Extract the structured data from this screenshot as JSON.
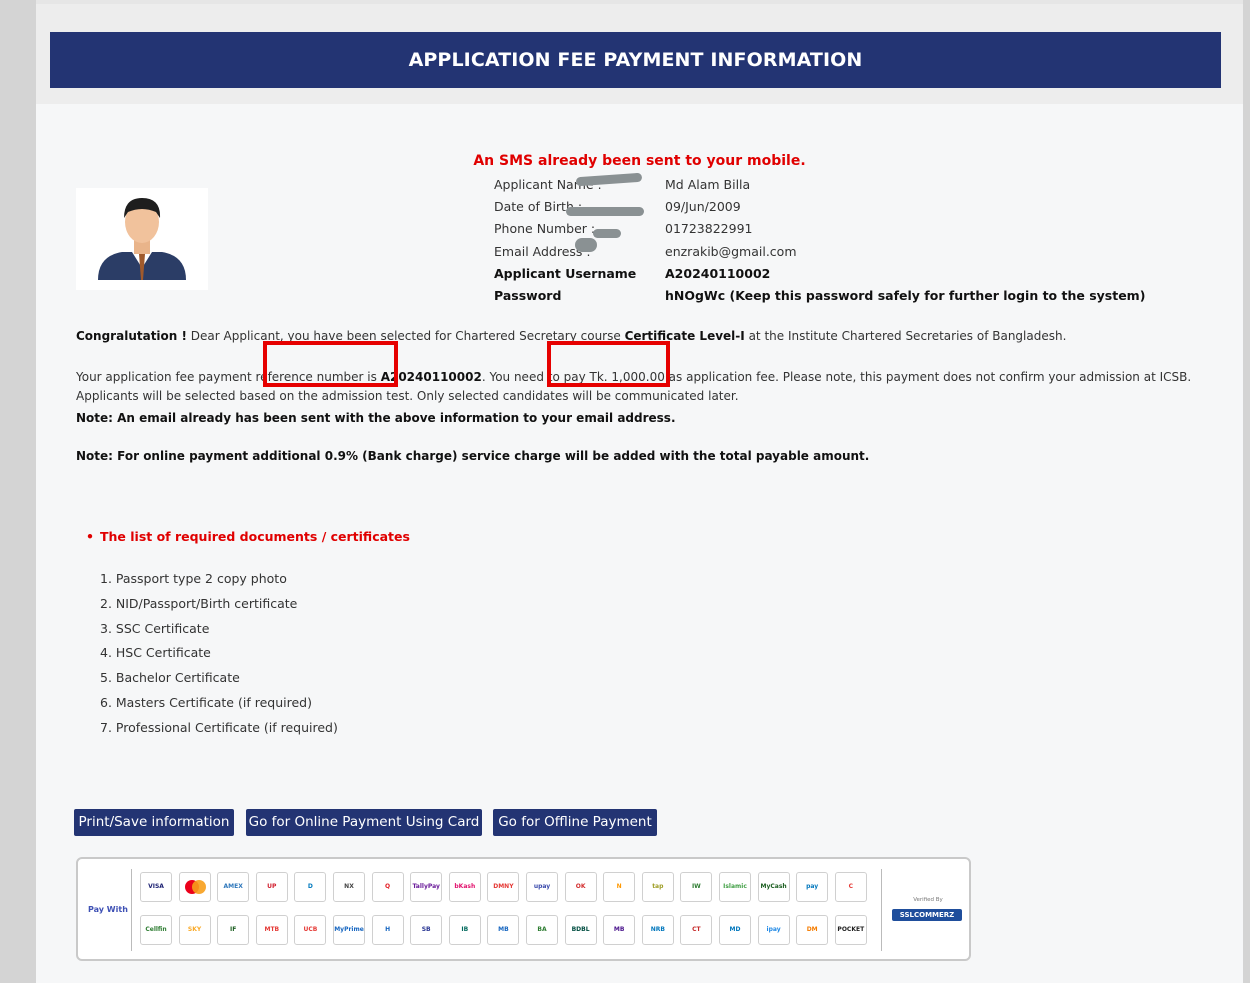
{
  "header": {
    "title": "APPLICATION FEE PAYMENT INFORMATION"
  },
  "sms_notice": "An SMS already been sent to your mobile.",
  "applicant": {
    "name_label": "Applicant Name :",
    "name": "Md Alam Billa",
    "dob_label": "Date of Birth :",
    "dob": "09/Jun/2009",
    "phone_label": "Phone Number :",
    "phone": "01723822991",
    "email_label": "Email Address :",
    "email": "enzrakib@gmail.com",
    "username_label": "Applicant Username",
    "username": "A20240110002",
    "password_label": "Password",
    "password": "hNOgWc  (Keep this password safely for further login to the system)"
  },
  "congrats": {
    "lead": "Congralutation !",
    "text1": " Dear Applicant, you have been selected for Chartered Secretary course ",
    "course": "Certificate Level-I",
    "text2": " at the Institute Chartered Secretaries of Bangladesh."
  },
  "payment_ref": {
    "text1": "Your application fee payment reference number is ",
    "ref": "A20240110002",
    "text2": ". You need to pay Tk. 1,000.00 as application fee. Please note, this payment does not confirm your admission at ICSB.",
    "line2": "Applicants will be selected based on the admission test. Only selected candidates will be communicated later."
  },
  "note_email": "Note: An email already has been sent with the above information to your email address.",
  "note_online": "Note: For online payment additional 0.9% (Bank charge) service charge will be added with the total payable amount.",
  "documents": {
    "title": "The list of required documents / certificates",
    "items": [
      "1. Passport type 2 copy photo",
      "2. NID/Passport/Birth certificate",
      "3. SSC Certificate",
      "4. HSC Certificate",
      "5. Bachelor Certificate",
      "6. Masters Certificate (if required)",
      "7. Professional Certificate (if required)"
    ]
  },
  "buttons": {
    "print": "Print/Save information",
    "online": "Go for Online Payment Using Card",
    "offline": "Go for Offline Payment"
  },
  "payment_panel": {
    "pay_with": "Pay With",
    "verified": "Verified By",
    "ssl": "SSLCOMMERZ",
    "row1": [
      {
        "name": "visa-logo",
        "text": "VISA",
        "color": "#1a1f71"
      },
      {
        "name": "mastercard-logo",
        "text": "",
        "color": "#eb001b"
      },
      {
        "name": "amex-logo",
        "text": "AMEX",
        "color": "#2e77bb"
      },
      {
        "name": "unionpay-logo",
        "text": "UP",
        "color": "#d21f2e"
      },
      {
        "name": "diners-logo",
        "text": "D",
        "color": "#0079be"
      },
      {
        "name": "dbbl-nexus-logo",
        "text": "NX",
        "color": "#444444"
      },
      {
        "name": "qcash-logo",
        "text": "Q",
        "color": "#e31e24"
      },
      {
        "name": "tallypay-logo",
        "text": "TallyPay",
        "color": "#6a1b9a"
      },
      {
        "name": "bkash-logo",
        "text": "bKash",
        "color": "#e2136e"
      },
      {
        "name": "dmoney-logo",
        "text": "DMNY",
        "color": "#e53935"
      },
      {
        "name": "upay-logo",
        "text": "upay",
        "color": "#3949ab"
      },
      {
        "name": "okwallet-logo",
        "text": "OK",
        "color": "#d32f2f"
      },
      {
        "name": "nagad-logo",
        "text": "N",
        "color": "#ff9800"
      },
      {
        "name": "tap-logo",
        "text": "tap",
        "color": "#9e9d24"
      },
      {
        "name": "islamic-wallet-logo",
        "text": "IW",
        "color": "#2e7d32"
      },
      {
        "name": "islamic-logo",
        "text": "Islamic",
        "color": "#43a047"
      },
      {
        "name": "mycash-logo",
        "text": "MyCash",
        "color": "#1b5e20"
      },
      {
        "name": "pocketpay-logo",
        "text": "pay",
        "color": "#0277bd"
      },
      {
        "name": "city-logo",
        "text": "C",
        "color": "#e53935"
      }
    ],
    "row2": [
      {
        "name": "celfin-logo",
        "text": "Cellfin",
        "color": "#2e7d32"
      },
      {
        "name": "sky-logo",
        "text": "SKY",
        "color": "#f9a825"
      },
      {
        "name": "ific-logo",
        "text": "IF",
        "color": "#1b5e20"
      },
      {
        "name": "mtb-logo",
        "text": "MTB",
        "color": "#e53935"
      },
      {
        "name": "ucb-logo",
        "text": "UCB",
        "color": "#e53935"
      },
      {
        "name": "myprime-logo",
        "text": "MyPrime",
        "color": "#1565c0"
      },
      {
        "name": "h-logo",
        "text": "H",
        "color": "#1565c0"
      },
      {
        "name": "sb-logo",
        "text": "SB",
        "color": "#283593"
      },
      {
        "name": "islami-bank-logo",
        "text": "IB",
        "color": "#00695c"
      },
      {
        "name": "mercantile-logo",
        "text": "MB",
        "color": "#1565c0"
      },
      {
        "name": "bank-asia-logo",
        "text": "BA",
        "color": "#2e7d32"
      },
      {
        "name": "bdbl-logo",
        "text": "BDBL",
        "color": "#004d40"
      },
      {
        "name": "meghna-logo",
        "text": "MB",
        "color": "#4a148c"
      },
      {
        "name": "nrb-logo",
        "text": "NRB",
        "color": "#0277bd"
      },
      {
        "name": "citizens-logo",
        "text": "CT",
        "color": "#c62828"
      },
      {
        "name": "modhumoti-logo",
        "text": "MD",
        "color": "#0277bd"
      },
      {
        "name": "ipay-logo",
        "text": "ipay",
        "color": "#1e88e5"
      },
      {
        "name": "dmoney2-logo",
        "text": "DM",
        "color": "#f57c00"
      },
      {
        "name": "pocket-logo",
        "text": "POCKET",
        "color": "#212121"
      }
    ]
  }
}
